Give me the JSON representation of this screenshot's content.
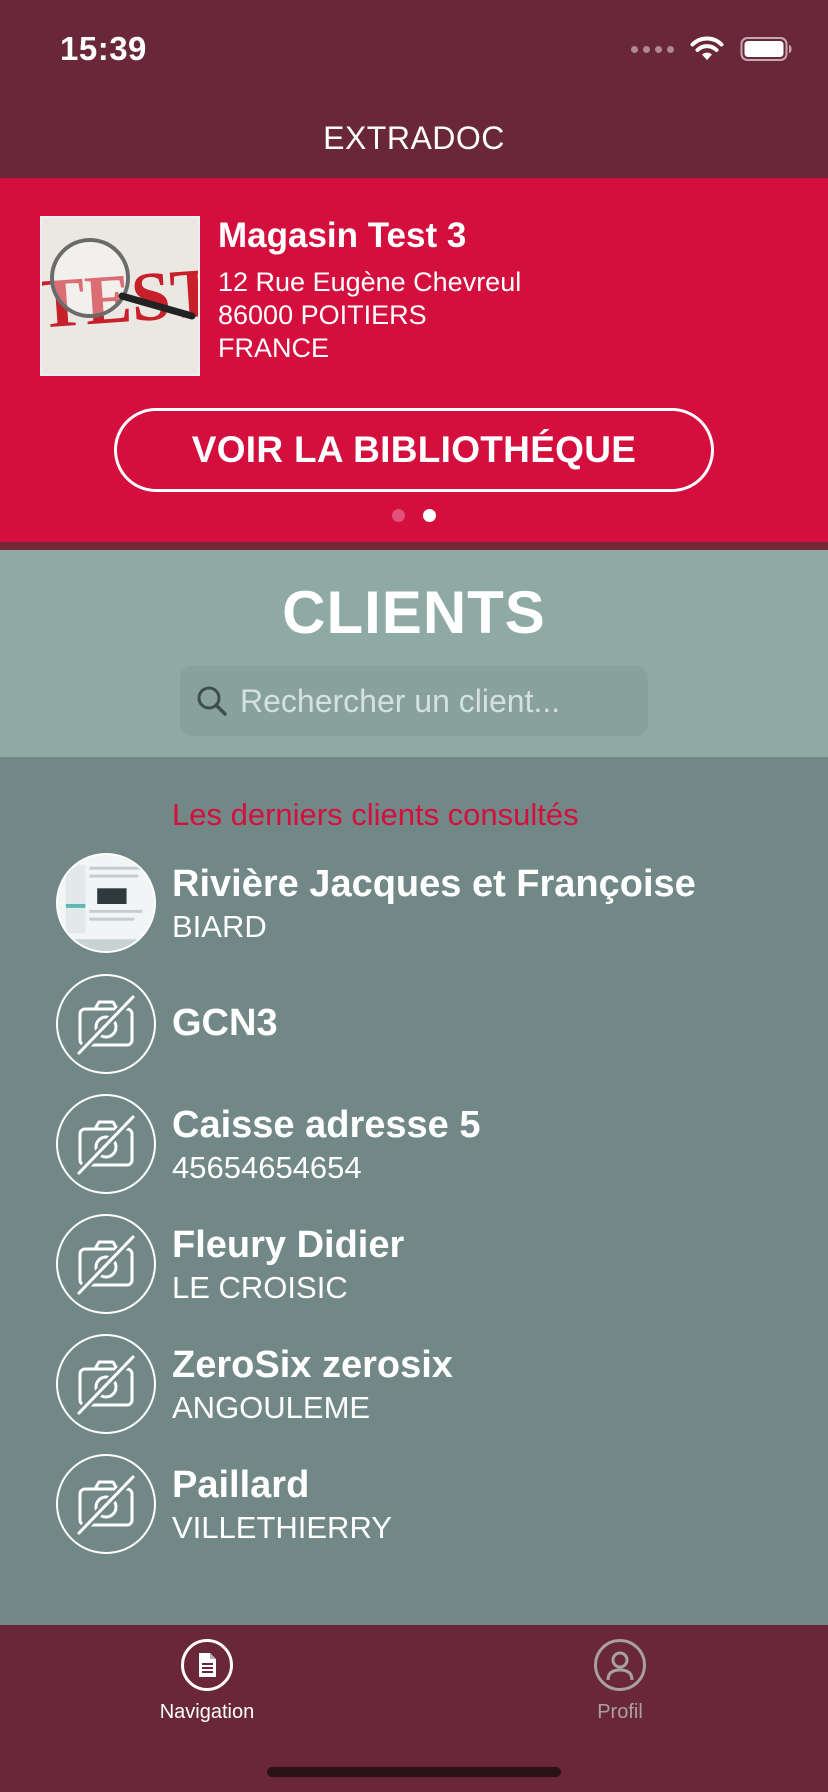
{
  "status_bar": {
    "time": "15:39"
  },
  "header": {
    "title": "EXTRADOC"
  },
  "store": {
    "name": "Magasin Test 3",
    "address_line1": "12 Rue Eugène Chevreul",
    "address_line2": "86000 POITIERS",
    "address_line3": "FRANCE",
    "thumbnail_text": "TEST",
    "library_button": "VOIR LA BIBLIOTHÉQUE",
    "page_dots": {
      "count": 2,
      "active_index": 1
    }
  },
  "clients": {
    "title": "CLIENTS",
    "search_placeholder": "Rechercher un client...",
    "recent_label": "Les derniers clients consultés",
    "items": [
      {
        "name": "Rivière Jacques et Françoise",
        "sub": "BIARD",
        "avatar": "photo"
      },
      {
        "name": "GCN3",
        "sub": "",
        "avatar": "no-photo"
      },
      {
        "name": "Caisse adresse 5",
        "sub": "45654654654",
        "avatar": "no-photo"
      },
      {
        "name": "Fleury Didier",
        "sub": "LE CROISIC",
        "avatar": "no-photo"
      },
      {
        "name": "ZeroSix zerosix",
        "sub": "ANGOULEME",
        "avatar": "no-photo"
      },
      {
        "name": "Paillard",
        "sub": "VILLETHIERRY",
        "avatar": "no-photo"
      }
    ]
  },
  "tab_bar": {
    "tabs": [
      {
        "label": "Navigation",
        "icon": "document-icon",
        "active": true
      },
      {
        "label": "Profil",
        "icon": "user-icon",
        "active": false
      }
    ]
  },
  "colors": {
    "header_bg": "#6a2739",
    "accent_red": "#d40e3d",
    "clients_head_bg": "#8faaa4",
    "clients_list_bg": "#728886"
  }
}
